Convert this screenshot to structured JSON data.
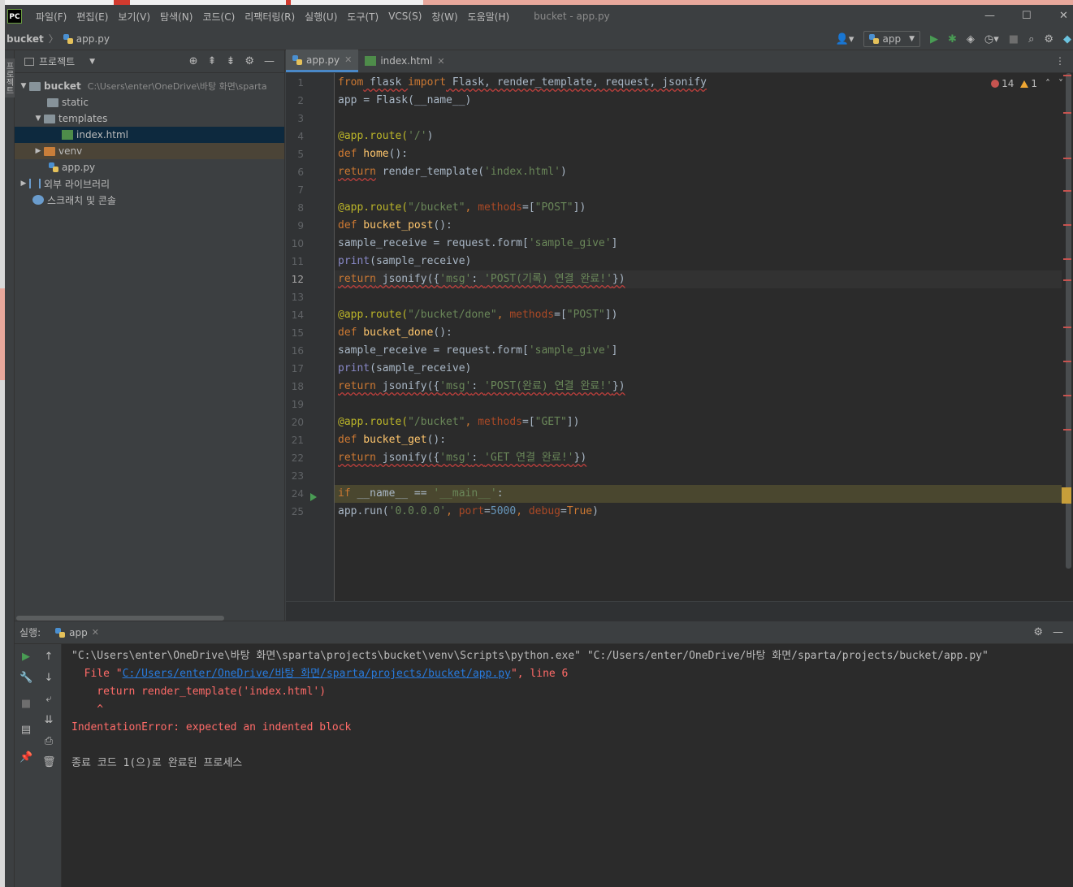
{
  "menu": {
    "items": [
      "파일(F)",
      "편집(E)",
      "보기(V)",
      "탐색(N)",
      "코드(C)",
      "리팩터링(R)",
      "실행(U)",
      "도구(T)",
      "VCS(S)",
      "창(W)",
      "도움말(H)"
    ],
    "window_title": "bucket - app.py"
  },
  "nav": {
    "project": "bucket",
    "file": "app.py",
    "run_config": "app"
  },
  "project_panel": {
    "title": "프로젝트",
    "tree": {
      "root_name": "bucket",
      "root_path": "C:\\Users\\enter\\OneDrive\\바탕 화면\\sparta",
      "static": "static",
      "templates": "templates",
      "index_html": "index.html",
      "venv": "venv",
      "app_py": "app.py",
      "external_libs": "외부 라이브러리",
      "scratches": "스크래치 및 콘솔"
    },
    "stripe_label": "프로젝트"
  },
  "editor": {
    "tabs": [
      "app.py",
      "index.html"
    ],
    "errors": "14",
    "warnings": "1",
    "line_numbers": [
      "1",
      "2",
      "3",
      "4",
      "5",
      "6",
      "7",
      "8",
      "9",
      "10",
      "11",
      "12",
      "13",
      "14",
      "15",
      "16",
      "17",
      "18",
      "19",
      "20",
      "21",
      "22",
      "23",
      "24",
      "25"
    ],
    "current_line": 12,
    "highlight_line": 24,
    "code": {
      "l1": {
        "a": "from",
        "b": " flask ",
        "c": "import",
        "d": " Flask, render_template, request, jsonify"
      },
      "l2": "app = Flask(__name__)",
      "l4": {
        "dec": "@app.route(",
        "s": "'/'",
        "e": ")"
      },
      "l5": {
        "kw": "def",
        "fn": " home",
        "e": "():"
      },
      "l6": {
        "kw": "return",
        "a": " render_template(",
        "s": "'index.html'",
        "e": ")"
      },
      "l8": {
        "dec": "@app.route(",
        "s": "\"/bucket\"",
        "c": ", ",
        "p": "methods",
        "eq": "=[",
        "m": "\"POST\"",
        "e": "])"
      },
      "l9": {
        "kw": "def",
        "fn": " bucket_post",
        "e": "():"
      },
      "l10": {
        "a": "sample_receive = request.form[",
        "s": "'sample_give'",
        "e": "]"
      },
      "l11": {
        "bi": "print",
        "e": "(sample_receive)"
      },
      "l12": {
        "kw": "return",
        "a": " jsonify({",
        "k": "'msg'",
        "c": ": ",
        "s": "'POST(기록) 연결 완료!'",
        "e": "})"
      },
      "l14": {
        "dec": "@app.route(",
        "s": "\"/bucket/done\"",
        "c": ", ",
        "p": "methods",
        "eq": "=[",
        "m": "\"POST\"",
        "e": "])"
      },
      "l15": {
        "kw": "def",
        "fn": " bucket_done",
        "e": "():"
      },
      "l16": {
        "a": "sample_receive = request.form[",
        "s": "'sample_give'",
        "e": "]"
      },
      "l17": {
        "bi": "print",
        "e": "(sample_receive)"
      },
      "l18": {
        "kw": "return",
        "a": " jsonify({",
        "k": "'msg'",
        "c": ": ",
        "s": "'POST(완료) 연결 완료!'",
        "e": "})"
      },
      "l20": {
        "dec": "@app.route(",
        "s": "\"/bucket\"",
        "c": ", ",
        "p": "methods",
        "eq": "=[",
        "m": "\"GET\"",
        "e": "])"
      },
      "l21": {
        "kw": "def",
        "fn": " bucket_get",
        "e": "():"
      },
      "l22": {
        "kw": "return",
        "a": " jsonify({",
        "k": "'msg'",
        "c": ": ",
        "s": "'GET 연결 완료!'",
        "e": "})"
      },
      "l24": {
        "kw": "if",
        "a": " __name__ == ",
        "s": "'__main__'",
        "e": ":"
      },
      "l25": {
        "a": "app.run(",
        "s": "'0.0.0.0'",
        "c": ", ",
        "p1": "port",
        "eq1": "=",
        "n": "5000",
        "c2": ", ",
        "p2": "debug",
        "eq2": "=",
        "kw": "True",
        "e": ")"
      }
    }
  },
  "run_panel": {
    "label": "실행:",
    "tab": "app",
    "console": {
      "cmd": "\"C:\\Users\\enter\\OneDrive\\바탕 화면\\sparta\\projects\\bucket\\venv\\Scripts\\python.exe\" \"C:/Users/enter/OneDrive/바탕 화면/sparta/projects/bucket/app.py\"",
      "file_prefix": "  File \"",
      "file_link": "C:/Users/enter/OneDrive/바탕 화면/sparta/projects/bucket/app.py",
      "file_suffix": "\", line 6",
      "code_line": "    return render_template('index.html')",
      "caret": "    ^",
      "error": "IndentationError: expected an indented block",
      "exit": "종료 코드 1(으)로 완료된 프로세스"
    }
  },
  "colors": {
    "keyword": "#cc7832",
    "string": "#6a8759",
    "function": "#ffc66d",
    "decorator": "#bbb529",
    "error_text": "#ff6b68",
    "link": "#287bde"
  }
}
